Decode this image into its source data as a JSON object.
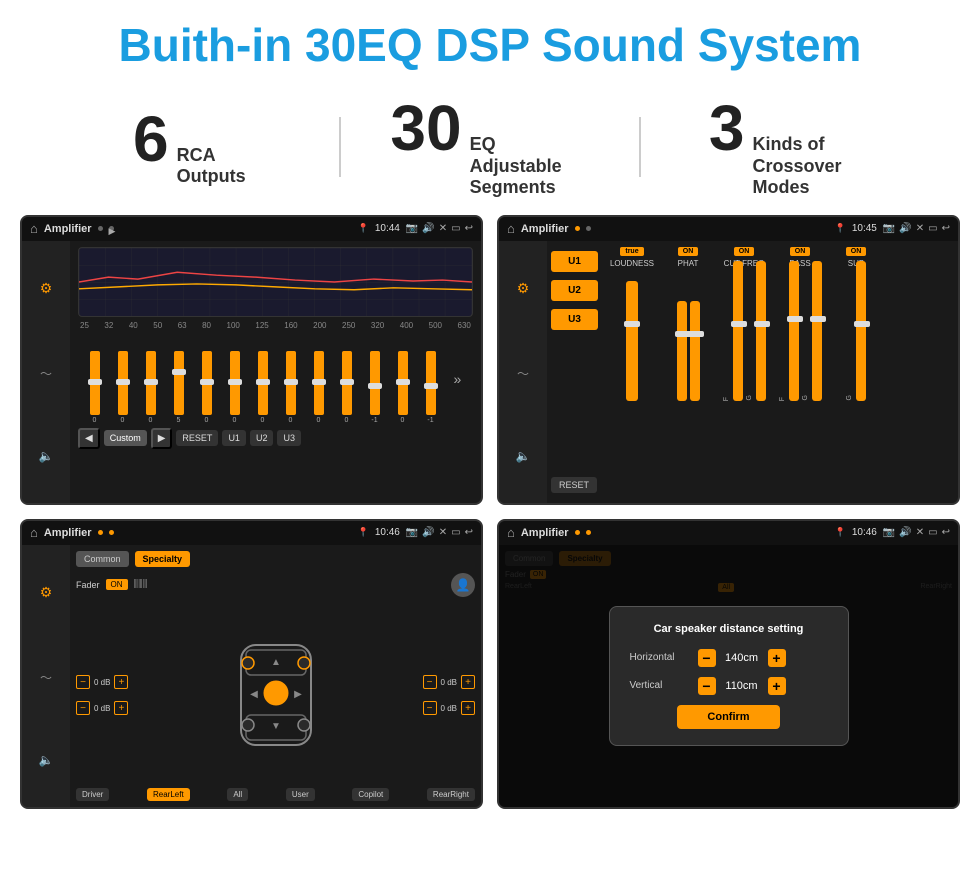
{
  "header": {
    "title": "Buith-in 30EQ DSP Sound System"
  },
  "stats": [
    {
      "number": "6",
      "desc": "RCA\nOutputs"
    },
    {
      "number": "30",
      "desc": "EQ Adjustable\nSegments"
    },
    {
      "number": "3",
      "desc": "Kinds of\nCrossover Modes"
    }
  ],
  "screens": [
    {
      "id": "screen1",
      "topbar": {
        "title": "Amplifier",
        "time": "10:44"
      },
      "type": "eq"
    },
    {
      "id": "screen2",
      "topbar": {
        "title": "Amplifier",
        "time": "10:45"
      },
      "type": "amp"
    },
    {
      "id": "screen3",
      "topbar": {
        "title": "Amplifier",
        "time": "10:46"
      },
      "type": "speaker"
    },
    {
      "id": "screen4",
      "topbar": {
        "title": "Amplifier",
        "time": "10:46"
      },
      "type": "dialog"
    }
  ],
  "eq_screen": {
    "freqs": [
      "25",
      "32",
      "40",
      "50",
      "63",
      "80",
      "100",
      "125",
      "160",
      "200",
      "250",
      "320",
      "400",
      "500",
      "630"
    ],
    "values": [
      "0",
      "0",
      "0",
      "5",
      "0",
      "0",
      "0",
      "0",
      "0",
      "0",
      "-1",
      "0",
      "-1"
    ],
    "buttons": [
      "Custom",
      "RESET",
      "U1",
      "U2",
      "U3"
    ]
  },
  "amp_screen": {
    "channels": [
      {
        "label": "LOUDNESS",
        "on": true
      },
      {
        "label": "PHAT",
        "on": true
      },
      {
        "label": "CUT FREQ",
        "on": true
      },
      {
        "label": "BASS",
        "on": true
      },
      {
        "label": "SUB",
        "on": true
      }
    ],
    "u_buttons": [
      "U1",
      "U2",
      "U3"
    ],
    "reset_label": "RESET"
  },
  "speaker_screen": {
    "tabs": [
      "Common",
      "Specialty"
    ],
    "active_tab": "Specialty",
    "fader_label": "Fader",
    "fader_on": "ON",
    "buttons": [
      "Driver",
      "RearLeft",
      "All",
      "User",
      "Copilot",
      "RearRight"
    ]
  },
  "dialog_screen": {
    "title": "Car speaker distance setting",
    "fields": [
      {
        "label": "Horizontal",
        "value": "140cm"
      },
      {
        "label": "Vertical",
        "value": "110cm"
      }
    ],
    "confirm_label": "Confirm"
  }
}
